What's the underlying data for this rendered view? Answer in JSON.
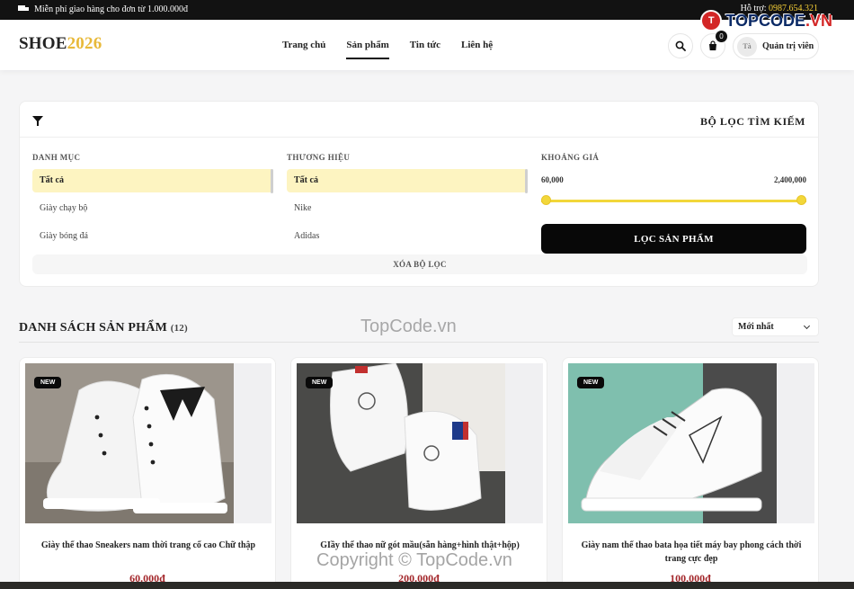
{
  "topbar": {
    "shipping": "Miễn phí giao hàng cho đơn từ 1.000.000đ",
    "hotline_label": "Hỗ trợ: ",
    "hotline_number": "0987.654.321"
  },
  "watermark": {
    "logo_text": "TOPCODE",
    "logo_suffix": ".VN",
    "center": "TopCode.vn",
    "copyright": "Copyright © TopCode.vn"
  },
  "header": {
    "logo_main": "SHOE",
    "logo_year": "2026",
    "nav": [
      "Trang chủ",
      "Sản phẩm",
      "Tin tức",
      "Liên hệ"
    ],
    "cart_count": "0",
    "avatar_alt": "Tà",
    "user_name": "Quản trị viên"
  },
  "filter": {
    "title": "BỘ LỌC TÌM KIẾM",
    "category_label": "DANH MỤC",
    "categories": [
      "Tất cả",
      "Giày chạy bộ",
      "Giày bóng đá"
    ],
    "brand_label": "THƯƠNG HIỆU",
    "brands": [
      "Tất cả",
      "Nike",
      "Adidas"
    ],
    "price_label": "KHOẢNG GIÁ",
    "price_min": "60,000",
    "price_max": "2,400,000",
    "apply_label": "LỌC SẢN PHẨM",
    "clear_label": "XÓA BỘ LỌC"
  },
  "list": {
    "title": "DANH SÁCH SẢN PHẨM",
    "count": "(12)",
    "sort_value": "Mới nhất"
  },
  "products": [
    {
      "tag": "NEW",
      "name": "Giày thể thao Sneakers nam thời trang cổ cao Chữ thập",
      "price": "60.000đ"
    },
    {
      "tag": "NEW",
      "name": "GIầy thể thao nữ gót mầu(sẵn hàng+hình thật+hộp)",
      "price": "200.000đ"
    },
    {
      "tag": "NEW",
      "name": "Giày nam thể thao bata họa tiết máy bay phong cách thời trang cực đẹp",
      "price": "100.000đ"
    }
  ],
  "colors": {
    "accent_yellow": "#f2d73a",
    "price_red": "#a3262a",
    "logo_gold": "#e8b93a"
  }
}
